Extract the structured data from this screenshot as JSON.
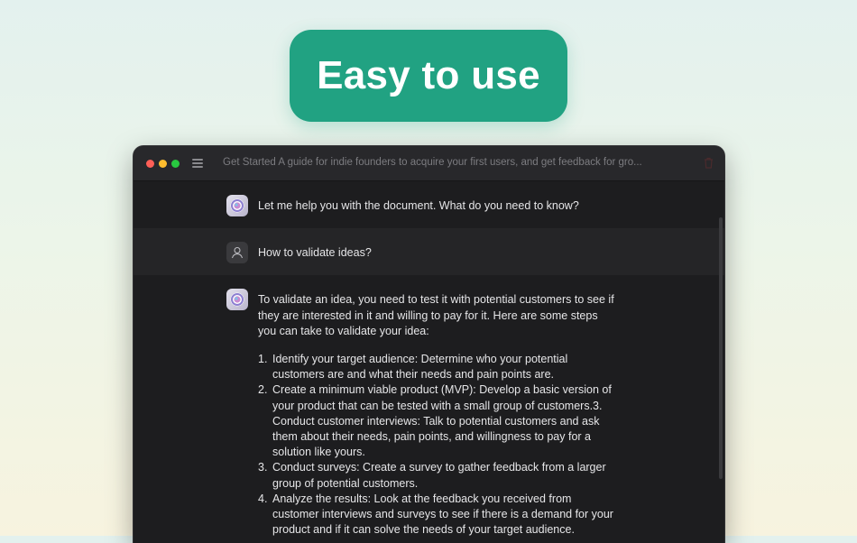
{
  "hero": {
    "label": "Easy to use"
  },
  "window": {
    "title": "Get Started A guide for indie founders to acquire your first users, and get feedback for gro..."
  },
  "messages": [
    {
      "role": "assistant",
      "text": "Let me help you with the document. What do you need to know?"
    },
    {
      "role": "user",
      "text": "How to validate ideas?"
    },
    {
      "role": "assistant",
      "intro": "To validate an idea, you need to test it with potential customers to see if they are interested in it and willing to pay for it. Here are some steps you can take to validate your idea:",
      "steps": [
        {
          "num": "1.",
          "text": "Identify your target audience: Determine who your potential customers are and what their needs and pain points are."
        },
        {
          "num": "2.",
          "text": "Create a minimum viable product (MVP): Develop a basic version of your product that can be tested with a small group of customers.3. Conduct customer interviews: Talk to potential customers and ask them about their needs, pain points, and willingness to pay for a solution like yours."
        },
        {
          "num": "3.",
          "text": "Conduct surveys: Create a survey to gather feedback from a larger group of potential customers."
        },
        {
          "num": "4.",
          "text": "Analyze the results: Look at the feedback you received from customer interviews and surveys to see if there is a demand for your product and if it can solve the needs of your target audience."
        }
      ]
    }
  ],
  "icons": {
    "app_avatar": "app-logo-icon",
    "user_avatar": "person-icon",
    "menu": "hamburger-menu-icon",
    "trash": "trash-icon"
  },
  "colors": {
    "accent": "#21a282",
    "window_bg": "#1d1d1f",
    "user_row_bg": "#252527",
    "close": "#fe5f57",
    "minimize": "#febc2e",
    "zoom": "#28c840"
  }
}
